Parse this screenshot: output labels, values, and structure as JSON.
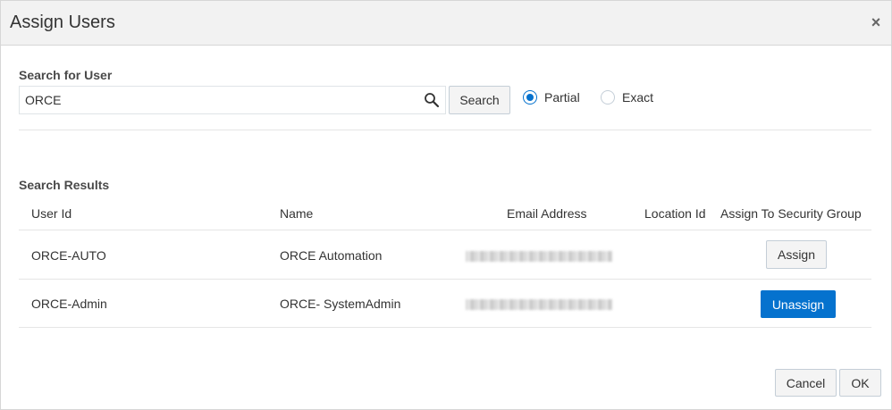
{
  "dialog": {
    "title": "Assign Users",
    "close_glyph": "×"
  },
  "search": {
    "section_label": "Search for User",
    "input_value": "ORCE",
    "search_button_label": "Search",
    "match_options": [
      {
        "label": "Partial",
        "selected": true
      },
      {
        "label": "Exact",
        "selected": false
      }
    ]
  },
  "results": {
    "section_label": "Search Results",
    "columns": [
      "User Id",
      "Name",
      "Email Address",
      "Location Id",
      "Assign To Security Group"
    ],
    "rows": [
      {
        "user_id": "ORCE-AUTO",
        "name": "ORCE Automation",
        "location_id": "",
        "action_label": "Assign",
        "action_type": "assign"
      },
      {
        "user_id": "ORCE-Admin",
        "name": "ORCE- SystemAdmin",
        "location_id": "",
        "action_label": "Unassign",
        "action_type": "unassign"
      }
    ]
  },
  "footer": {
    "cancel_label": "Cancel",
    "ok_label": "OK"
  },
  "colors": {
    "primary": "#0572ce",
    "header_bg": "#f2f2f2",
    "border": "#d6d6d6"
  },
  "icons": {
    "search": "magnifier-icon",
    "close": "close-icon"
  }
}
